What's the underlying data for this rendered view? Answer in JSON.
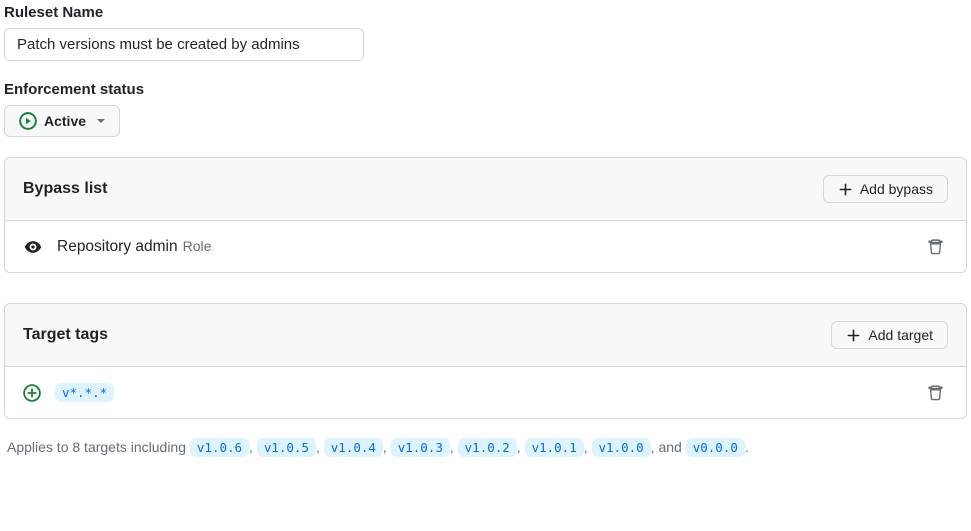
{
  "ruleset": {
    "name_label": "Ruleset Name",
    "name_value": "Patch versions must be created by admins"
  },
  "enforcement": {
    "label": "Enforcement status",
    "status": "Active"
  },
  "bypass": {
    "title": "Bypass list",
    "add_label": "Add bypass",
    "items": [
      {
        "name": "Repository admin",
        "meta": "Role"
      }
    ]
  },
  "targets": {
    "title": "Target tags",
    "add_label": "Add target",
    "patterns": [
      "v*.*.*"
    ],
    "footer_prefix": "Applies to 8 targets including",
    "footer_and": ", and",
    "footer_end": ".",
    "tags": [
      "v1.0.6",
      "v1.0.5",
      "v1.0.4",
      "v1.0.3",
      "v1.0.2",
      "v1.0.1",
      "v1.0.0",
      "v0.0.0"
    ]
  },
  "colors": {
    "accent_blue": "#0969da",
    "success_green": "#1a7f37",
    "border": "#d0d7de"
  }
}
